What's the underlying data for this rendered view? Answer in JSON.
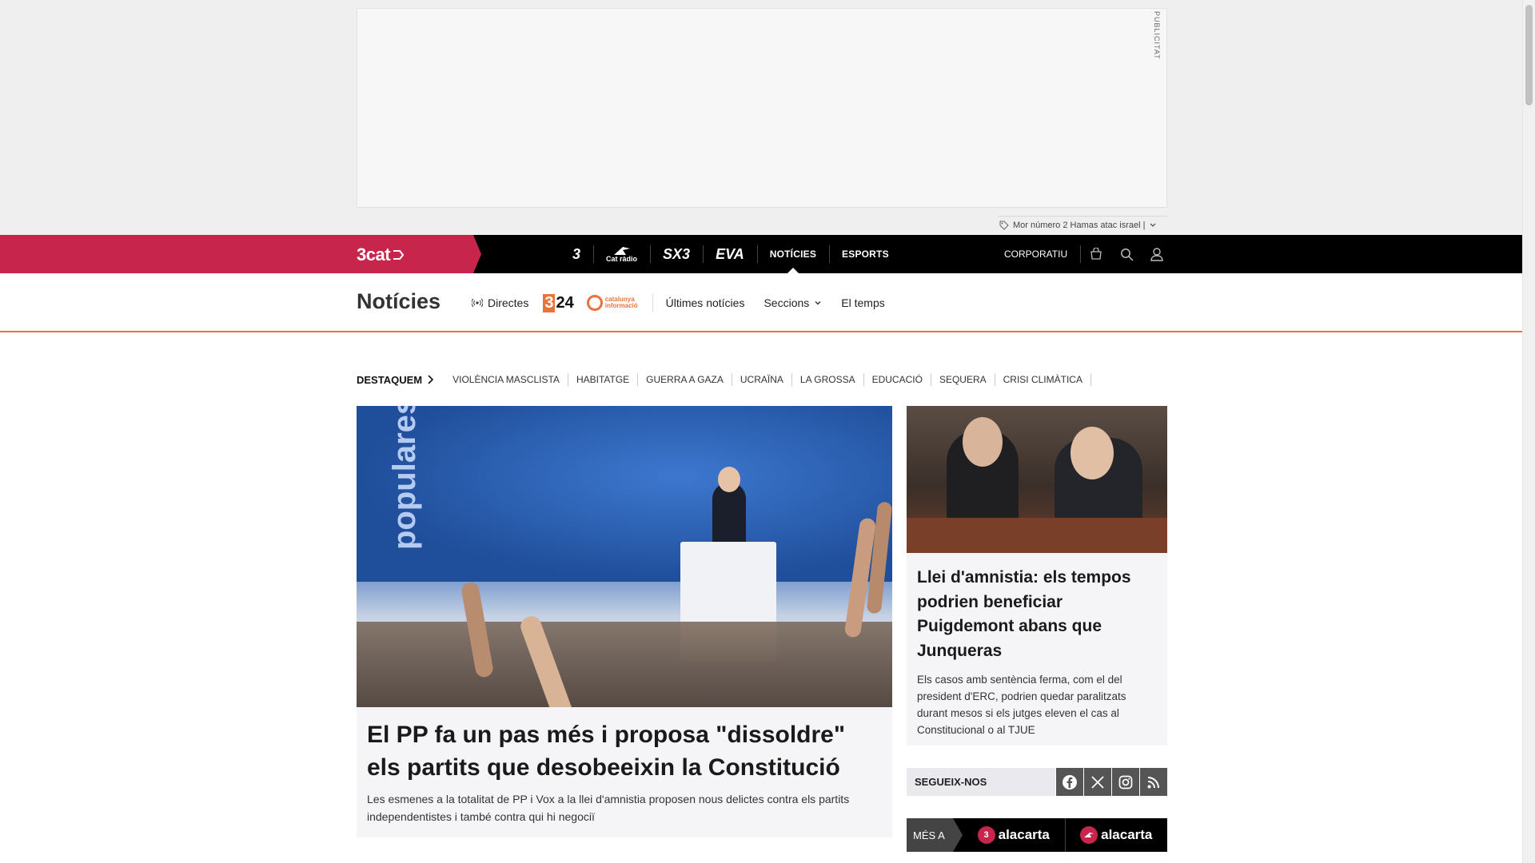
{
  "ad": {
    "label": "PUBLICITAT",
    "topic_strip": "Mor número 2 Hamas atac israel |"
  },
  "topnav": {
    "brand": "3cat",
    "channels": [
      {
        "label": "3",
        "kind": "logo"
      },
      {
        "label": "Cat ràdio",
        "kind": "logo"
      },
      {
        "label": "SX3",
        "kind": "logo"
      },
      {
        "label": "EVA",
        "kind": "logo"
      },
      {
        "label": "NOTÍCIES",
        "kind": "text",
        "active": true
      },
      {
        "label": "ESPORTS",
        "kind": "text"
      }
    ],
    "corporatiu": "CORPORATIU"
  },
  "section": {
    "title": "Notícies",
    "directes": "Directes",
    "logo_324_a": "3",
    "logo_324_b": "24",
    "catinf_line1": "catalunya",
    "catinf_line2": "informació",
    "links": [
      "Últimes notícies",
      "Seccions",
      "El temps"
    ]
  },
  "destaquem": {
    "label": "DESTAQUEM",
    "items": [
      "VIOLÈNCIA MASCLISTA",
      "HABITATGE",
      "GUERRA A GAZA",
      "UCRAÏNA",
      "LA GROSSA",
      "EDUCACIÓ",
      "SEQUERA",
      "CRISI CLIMÀTICA"
    ]
  },
  "main_article": {
    "image_text": "populares",
    "title": "El PP fa un pas més i proposa \"dissoldre\" els partits que desobeeixin la Constitució",
    "summary": "Les esmenes a la totalitat de PP i Vox a la llei d'amnistia proposen nous delictes contra els partits independentistes i també contra qui hi negociï"
  },
  "side_article": {
    "title": "Llei d'amnistia: els tempos podrien beneficiar Puigdemont abans que Junqueras",
    "summary": "Els casos amb sentència ferma, com el del president d'ERC, podrien quedar paralitzats durant mesos si els jutges eleven el cas al Constitucional o al TJUE"
  },
  "follow": {
    "label": "SEGUEIX-NOS",
    "networks": [
      "facebook",
      "x",
      "instagram",
      "rss"
    ]
  },
  "mesa": {
    "label": "MÉS A",
    "items": [
      {
        "badge": "3",
        "text": "alacarta"
      },
      {
        "badge": "",
        "text": "alacarta"
      }
    ]
  },
  "colors": {
    "brand": "#c8254d",
    "news_accent": "#e8743b",
    "topnav_bg": "#000000"
  }
}
